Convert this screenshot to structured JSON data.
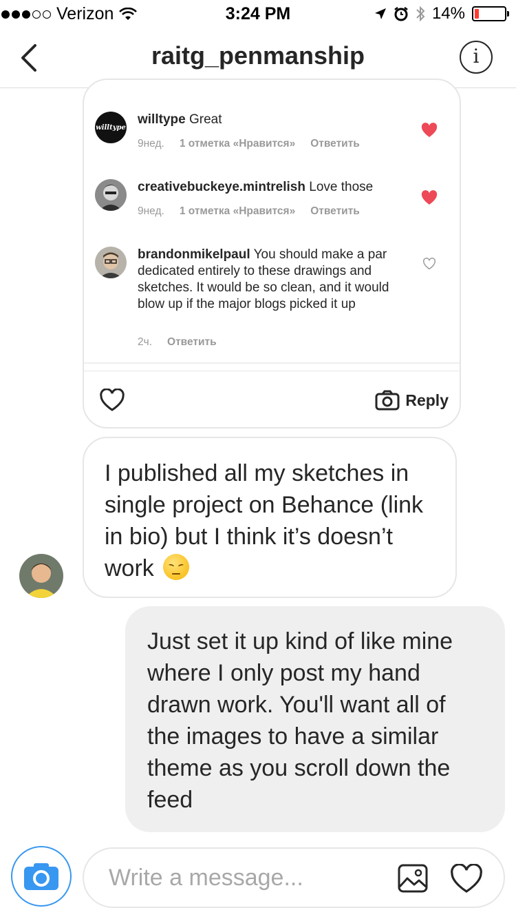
{
  "status_bar": {
    "carrier": "Verizon",
    "time": "3:24 PM",
    "battery": "14%",
    "battery_level": 0.14,
    "signal_bars": 3
  },
  "header": {
    "title": "raitg_penmanship",
    "info_label": "i"
  },
  "shared_post": {
    "comments": [
      {
        "username": "willtype",
        "text": " Great",
        "time": "9нед.",
        "likes": "1 отметка «Нравится»",
        "reply": "Ответить",
        "liked": true,
        "avatar_text": "willtype"
      },
      {
        "username": "creativebuckeye.mintrelish",
        "text": " Love those",
        "time": "9нед.",
        "likes": "1 отметка «Нравится»",
        "reply": "Ответить",
        "liked": true
      },
      {
        "username": "brandonmikelpaul",
        "text": " You should make a par dedicated entirely to these drawings and sketches. It would be so clean, and it would blow up if the major blogs picked it up",
        "time": "2ч.",
        "reply": "Ответить",
        "liked": false
      }
    ],
    "reply_label": "Reply"
  },
  "messages": {
    "incoming": "I published all my sketches in single project on Behance (link in bio) but I think it’s doesn’t work",
    "outgoing": "Just set it up kind of like mine where I only post my hand drawn work. You'll want all of the images to have a similar theme as you scroll down the feed"
  },
  "composer": {
    "placeholder": "Write a message..."
  },
  "colors": {
    "accent": "#3897f0",
    "heart_liked": "#ed4956",
    "bubble_out": "#efefef",
    "border": "#e6e6e6",
    "battery_low": "#ff3b30"
  }
}
